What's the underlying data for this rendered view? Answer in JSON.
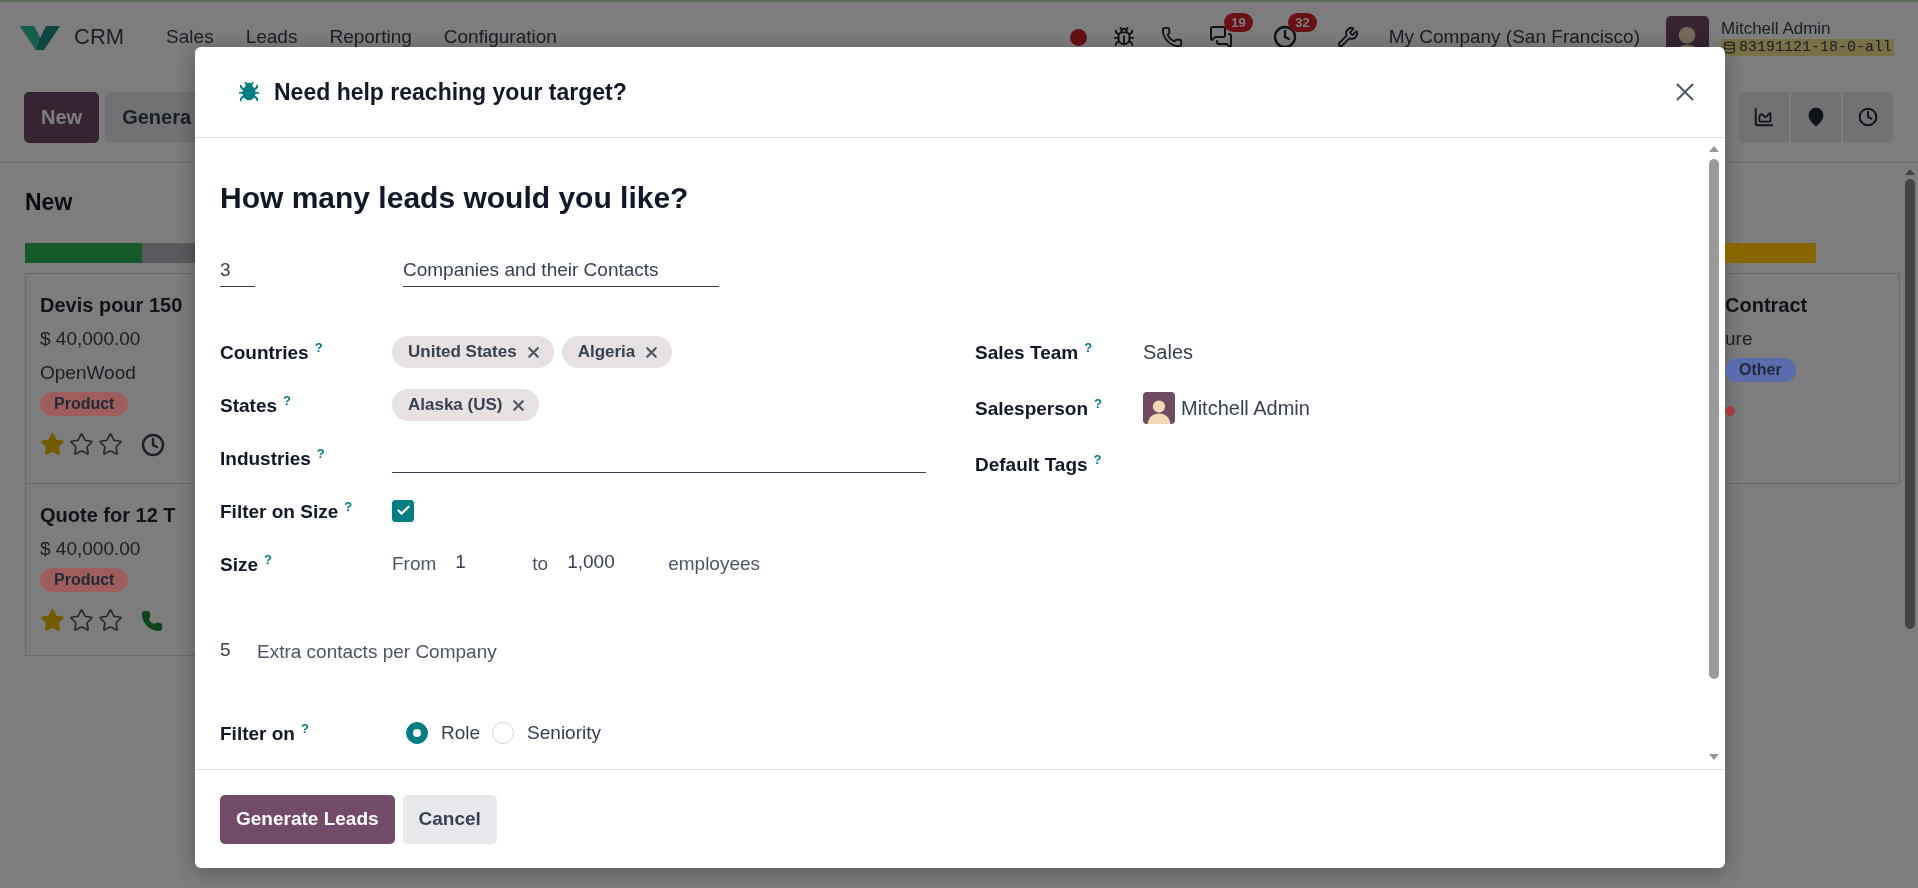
{
  "navbar": {
    "app_name": "CRM",
    "menu": [
      {
        "label": "Sales"
      },
      {
        "label": "Leads"
      },
      {
        "label": "Reporting"
      },
      {
        "label": "Configuration"
      }
    ],
    "systray": {
      "chat_count": "19",
      "activity_count": "32"
    },
    "company": "My Company (San Francisco)",
    "user": {
      "name": "Mitchell Admin",
      "database": "83191121-18-0-all"
    }
  },
  "control_panel": {
    "buttons": [
      {
        "label": "New",
        "kind": "primary"
      },
      {
        "label": "Genera",
        "kind": "secondary"
      }
    ],
    "views": [
      {
        "kind": "graph"
      },
      {
        "kind": "map"
      },
      {
        "kind": "activity"
      }
    ]
  },
  "kanban": {
    "columns": [
      {
        "title": "New",
        "progress": {
          "level": 0.5,
          "color": "#145a2a"
        },
        "cards": [
          {
            "title": "Devis pour 150",
            "amount": "$ 40,000.00",
            "customer": "OpenWood",
            "tags": [
              {
                "label": "Product",
                "color": "#9e5f5c"
              }
            ],
            "stars": 1,
            "activity": {
              "kind": "clock"
            }
          },
          {
            "title": "Quote for 12 T",
            "amount": "$ 40,000.00",
            "tags": [
              {
                "label": "Product",
                "color": "#9e5f5c"
              }
            ],
            "stars": 1,
            "activity": {
              "kind": "phone"
            }
          }
        ]
      },
      {
        "progress": {
          "level": 1,
          "color": "#876600"
        },
        "cards": [
          {
            "title": "Contract",
            "customer": "ure",
            "tags": [
              {
                "label": "Other",
                "color": "#5a6cae"
              }
            ],
            "activity": {
              "kind": "dot"
            }
          }
        ]
      }
    ]
  },
  "dialog": {
    "title": "Need help reaching your target?",
    "heading": "How many leads would you like?",
    "lead_count": "3",
    "lead_type": "Companies and their Contacts",
    "left_fields": [
      {
        "label": "Countries",
        "help": "?",
        "kind": "tags",
        "tags": [
          "United States",
          "Algeria"
        ]
      },
      {
        "label": "States",
        "help": "?",
        "kind": "tags",
        "tags": [
          "Alaska (US)"
        ]
      },
      {
        "label": "Industries",
        "help": "?",
        "kind": "input"
      },
      {
        "label": "Filter on Size",
        "help": "?",
        "kind": "checkbox",
        "checked": true
      },
      {
        "label": "Size",
        "help": "?",
        "kind": "range",
        "prefix": "From",
        "from": "1",
        "middle": "to",
        "to": "1,000",
        "suffix": "employees"
      }
    ],
    "right_fields": [
      {
        "label": "Sales Team",
        "help": "?",
        "kind": "text",
        "value": "Sales"
      },
      {
        "label": "Salesperson",
        "help": "?",
        "kind": "user",
        "value": "Mitchell Admin"
      },
      {
        "label": "Default Tags",
        "help": "?",
        "kind": "tags"
      }
    ],
    "extra_contacts": {
      "count": "5",
      "label": "Extra contacts per Company"
    },
    "filter_on": {
      "label": "Filter on",
      "help": "?",
      "options": [
        {
          "label": "Role",
          "selected": true
        },
        {
          "label": "Seniority",
          "selected": false
        }
      ]
    },
    "footer": {
      "buttons": [
        {
          "label": "Generate Leads",
          "kind": "primary"
        },
        {
          "label": "Cancel",
          "kind": "secondary"
        }
      ]
    }
  }
}
